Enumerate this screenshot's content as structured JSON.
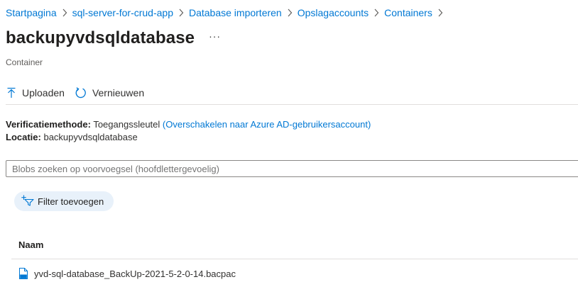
{
  "breadcrumb": {
    "items": [
      "Startpagina",
      "sql-server-for-crud-app",
      "Database importeren",
      "Opslagaccounts",
      "Containers"
    ]
  },
  "header": {
    "title": "backupyvdsqldatabase",
    "more": "···",
    "subtitle": "Container"
  },
  "toolbar": {
    "upload_label": "Uploaden",
    "refresh_label": "Vernieuwen"
  },
  "info": {
    "auth_label": "Verificatiemethode:",
    "auth_value": "Toegangssleutel",
    "auth_link": "(Overschakelen naar Azure AD-gebruikersaccount)",
    "location_label": "Locatie:",
    "location_value": "backupyvdsqldatabase"
  },
  "search": {
    "placeholder": "Blobs zoeken op voorvoegsel (hoofdlettergevoelig)"
  },
  "filter": {
    "label": "Filter toevoegen"
  },
  "table": {
    "columns": [
      "Naam"
    ],
    "rows": [
      {
        "name": "yvd-sql-database_BackUp-2021-5-2-0-14.bacpac"
      }
    ]
  },
  "colors": {
    "link": "#0078d4",
    "pill_bg": "#e8f1fa"
  }
}
